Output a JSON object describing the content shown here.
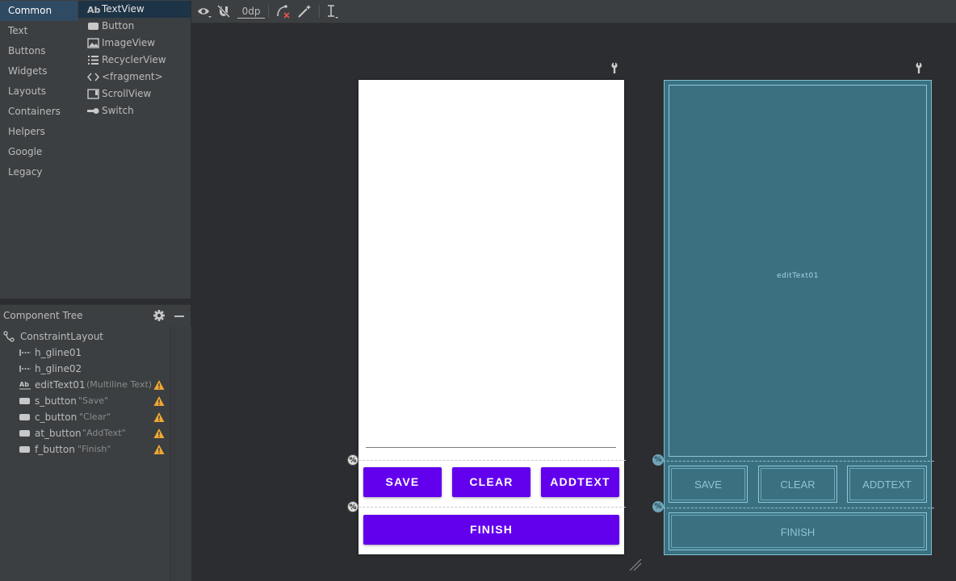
{
  "palette": {
    "categories": [
      {
        "label": "Common",
        "selected": true
      },
      {
        "label": "Text"
      },
      {
        "label": "Buttons"
      },
      {
        "label": "Widgets"
      },
      {
        "label": "Layouts"
      },
      {
        "label": "Containers"
      },
      {
        "label": "Helpers"
      },
      {
        "label": "Google"
      },
      {
        "label": "Legacy"
      }
    ],
    "items": [
      {
        "label": "TextView",
        "icon": "textview-icon",
        "selected": true
      },
      {
        "label": "Button",
        "icon": "button-icon"
      },
      {
        "label": "ImageView",
        "icon": "image-icon"
      },
      {
        "label": "RecyclerView",
        "icon": "list-icon"
      },
      {
        "label": "<fragment>",
        "icon": "code-brackets-icon"
      },
      {
        "label": "ScrollView",
        "icon": "scrollview-icon"
      },
      {
        "label": "Switch",
        "icon": "switch-icon"
      }
    ]
  },
  "tree": {
    "title": "Component Tree",
    "root": {
      "label": "ConstraintLayout",
      "icon": "constraint-layout-icon"
    },
    "nodes": [
      {
        "name": "h_gline01",
        "desc": "",
        "icon": "guideline-icon",
        "warning": false
      },
      {
        "name": "h_gline02",
        "desc": "",
        "icon": "guideline-icon",
        "warning": false
      },
      {
        "name": "editText01",
        "desc": "(Multiline Text)",
        "icon": "textview-icon",
        "warning": true
      },
      {
        "name": "s_button",
        "desc": "\"Save\"",
        "icon": "button-icon",
        "warning": true
      },
      {
        "name": "c_button",
        "desc": "\"Clear\"",
        "icon": "button-icon",
        "warning": true
      },
      {
        "name": "at_button",
        "desc": "\"AddText\"",
        "icon": "button-icon",
        "warning": true
      },
      {
        "name": "f_button",
        "desc": "\"Finish\"",
        "icon": "button-icon",
        "warning": true
      }
    ]
  },
  "toolbar": {
    "margin": "0dp",
    "icons": [
      "eye-icon",
      "magnet-off-icon",
      "clear-constraints-icon",
      "magic-wand-icon",
      "vertical-guidelines-icon"
    ]
  },
  "design": {
    "buttons": {
      "save": "SAVE",
      "clear": "CLEAR",
      "addtext": "ADDTEXT",
      "finish": "FINISH"
    },
    "guideline_marker": "%"
  },
  "blueprint": {
    "edit_label": "editText01",
    "buttons": {
      "save": "SAVE",
      "clear": "CLEAR",
      "addtext": "ADDTEXT",
      "finish": "FINISH"
    }
  },
  "colors": {
    "accent": "#6200ee",
    "blueprint_bg": "#3a7080",
    "selection": "#2f4a63",
    "warning": "#f0a732"
  }
}
